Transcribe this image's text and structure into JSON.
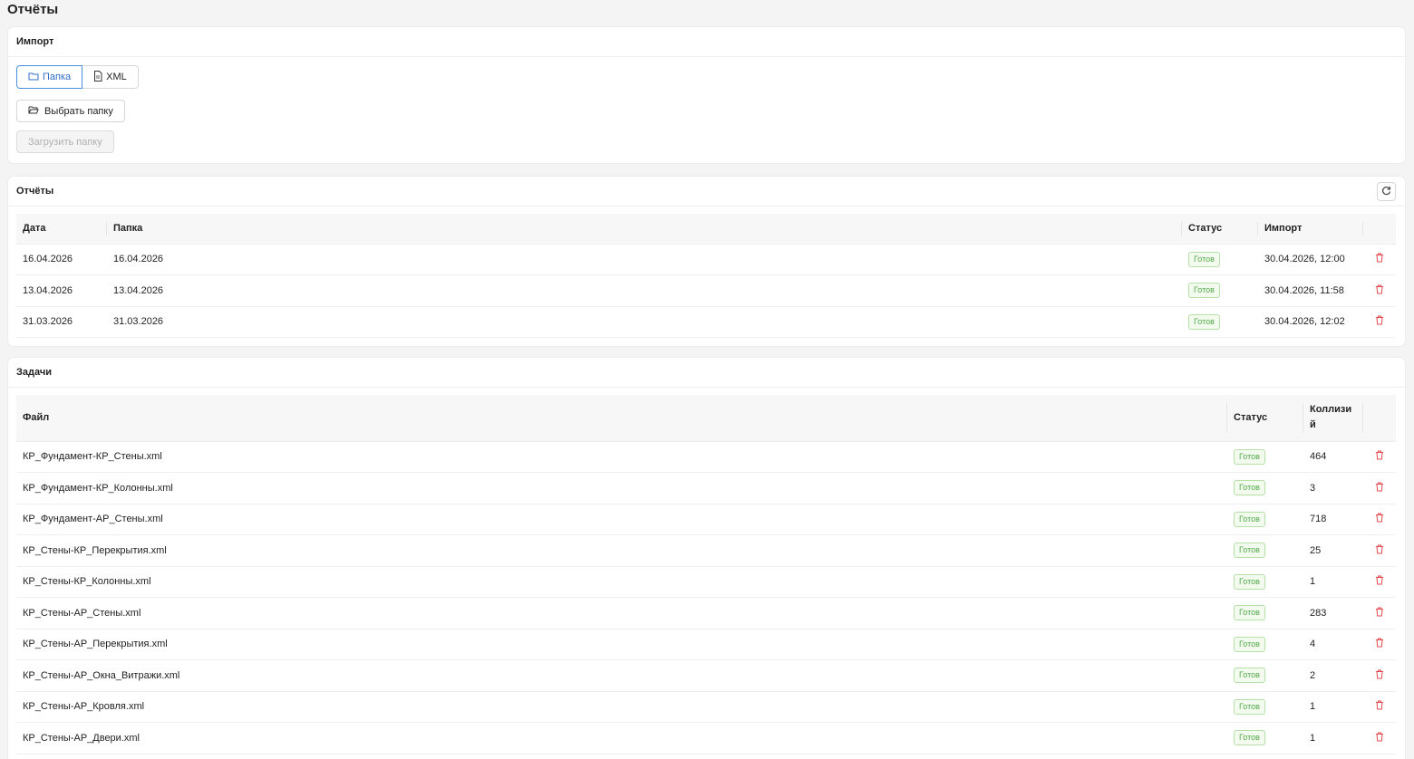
{
  "page_title": "Отчёты",
  "import_section": {
    "title": "Импорт",
    "tabs": [
      {
        "label": "Папка",
        "icon": "folder-icon",
        "active": true
      },
      {
        "label": "XML",
        "icon": "file-icon",
        "active": false
      }
    ],
    "choose_folder_label": "Выбрать папку",
    "upload_folder_label": "Загрузить папку"
  },
  "reports_section": {
    "title": "Отчёты",
    "columns": {
      "date": "Дата",
      "folder": "Папка",
      "status": "Статус",
      "import": "Импорт"
    },
    "rows": [
      {
        "date": "16.04.2026",
        "folder": "16.04.2026",
        "status": "Готов",
        "import": "30.04.2026, 12:00"
      },
      {
        "date": "13.04.2026",
        "folder": "13.04.2026",
        "status": "Готов",
        "import": "30.04.2026, 11:58"
      },
      {
        "date": "31.03.2026",
        "folder": "31.03.2026",
        "status": "Готов",
        "import": "30.04.2026, 12:02"
      }
    ]
  },
  "tasks_section": {
    "title": "Задачи",
    "columns": {
      "file": "Файл",
      "status": "Статус",
      "collisions": "Коллизи\nй"
    },
    "rows": [
      {
        "file": "КР_Фундамент-КР_Стены.xml",
        "status": "Готов",
        "collisions": "464"
      },
      {
        "file": "КР_Фундамент-КР_Колонны.xml",
        "status": "Готов",
        "collisions": "3"
      },
      {
        "file": "КР_Фундамент-АР_Стены.xml",
        "status": "Готов",
        "collisions": "718"
      },
      {
        "file": "КР_Стены-КР_Перекрытия.xml",
        "status": "Готов",
        "collisions": "25"
      },
      {
        "file": "КР_Стены-КР_Колонны.xml",
        "status": "Готов",
        "collisions": "1"
      },
      {
        "file": "КР_Стены-АР_Стены.xml",
        "status": "Готов",
        "collisions": "283"
      },
      {
        "file": "КР_Стены-АР_Перекрытия.xml",
        "status": "Готов",
        "collisions": "4"
      },
      {
        "file": "КР_Стены-АР_Окна_Витражи.xml",
        "status": "Готов",
        "collisions": "2"
      },
      {
        "file": "КР_Стены-АР_Кровля.xml",
        "status": "Готов",
        "collisions": "1"
      },
      {
        "file": "КР_Стены-АР_Двери.xml",
        "status": "Готов",
        "collisions": "1"
      }
    ]
  },
  "colors": {
    "accent": "#2f6fc8",
    "success": "#52a84a",
    "danger": "#e5484d"
  }
}
